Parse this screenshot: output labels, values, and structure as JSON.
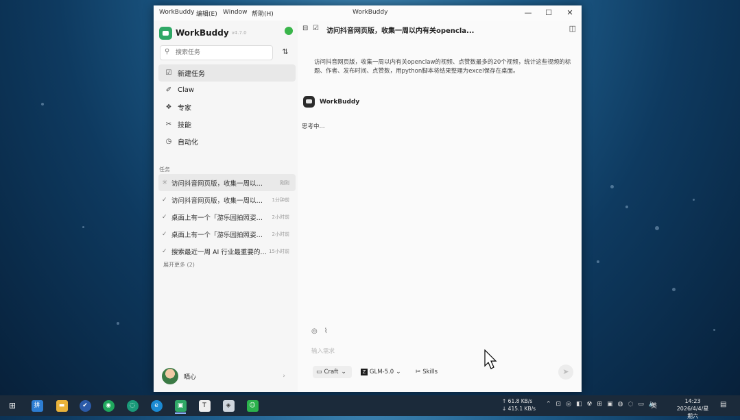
{
  "window": {
    "menus": [
      "WorkBuddy",
      "编辑(E)",
      "Window",
      "帮助(H)"
    ],
    "title": "WorkBuddy",
    "controls": {
      "minimize": "—",
      "maximize": "☐",
      "close": "✕"
    }
  },
  "sidebar": {
    "brand": "WorkBuddy",
    "version": "v4.7.0",
    "search_placeholder": "搜索任务",
    "nav": [
      {
        "label": "新建任务",
        "icon": "new-task-icon",
        "glyph": "☑"
      },
      {
        "label": "Claw",
        "icon": "claw-icon",
        "glyph": "✐"
      },
      {
        "label": "专家",
        "icon": "layers-icon",
        "glyph": "❖"
      },
      {
        "label": "技能",
        "icon": "wand-icon",
        "glyph": "✂"
      },
      {
        "label": "自动化",
        "icon": "clock-icon",
        "glyph": "◷"
      }
    ],
    "tasks_label": "任务",
    "tasks": [
      {
        "title": "访问抖音网页版，收集一周以内有关openclaw的视频",
        "time": "刚刚",
        "status": "running",
        "glyph": "☼"
      },
      {
        "title": "访问抖音网页版，收集一周以内有关openclaw的视频",
        "time": "1分钟前",
        "status": "done",
        "glyph": "✓"
      },
      {
        "title": "桌面上有一个「游乐园拍照姿势」文件",
        "time": "2小时前",
        "status": "done",
        "glyph": "✓"
      },
      {
        "title": "桌面上有一个「游乐园拍照姿势」文件",
        "time": "2小时前",
        "status": "done",
        "glyph": "✓"
      },
      {
        "title": "搜索最近一周 AI 行业最重要的新闻",
        "time": "15小时前",
        "status": "done",
        "glyph": "✓"
      }
    ],
    "expand_more": "展开更多 (2)",
    "user": {
      "name": "晒心",
      "chevron": "›"
    }
  },
  "main": {
    "title": "访问抖音网页版，收集一周以内有关opencla...",
    "user_message": "访问抖音网页版，收集一周以内有关openclaw的视频、点赞数最多的20个视频，统计这些视频的标题、作者、发布时间、点赞数，用python脚本将结果整理为excel保存在桌面。",
    "bot_name": "WorkBuddy",
    "bot_status": "思考中...",
    "composer": {
      "placeholder": "输入需求",
      "mode": "Craft",
      "model": "GLM-5.0",
      "skills": "Skills"
    }
  },
  "taskbar": {
    "apps": [
      {
        "name": "start-icon",
        "glyph": "⊞"
      },
      {
        "name": "ime-app-icon",
        "glyph": "拼"
      },
      {
        "name": "file-explorer-icon",
        "glyph": "▬"
      },
      {
        "name": "ticktick-icon",
        "glyph": "✔"
      },
      {
        "name": "browser-icon",
        "glyph": "◉"
      },
      {
        "name": "loading-app-icon",
        "glyph": "◌"
      },
      {
        "name": "edge-icon",
        "glyph": "e"
      },
      {
        "name": "workbuddy-taskbar-icon",
        "glyph": "▣"
      },
      {
        "name": "typora-icon",
        "glyph": "T"
      },
      {
        "name": "app-icon",
        "glyph": "◈"
      },
      {
        "name": "wechat-icon",
        "glyph": "☺"
      }
    ],
    "net_up": "↑ 61.8 KB/s",
    "net_down": "↓ 415.1 KB/s",
    "tray_glyphs": [
      "⌃",
      "⊡",
      "◎",
      "◧",
      "☢",
      "⊞",
      "▣",
      "◍",
      "◌",
      "▭",
      "🔈"
    ],
    "ime": "英",
    "time": "14:23",
    "date": "2026/4/4/星期六",
    "notification": "▤"
  }
}
